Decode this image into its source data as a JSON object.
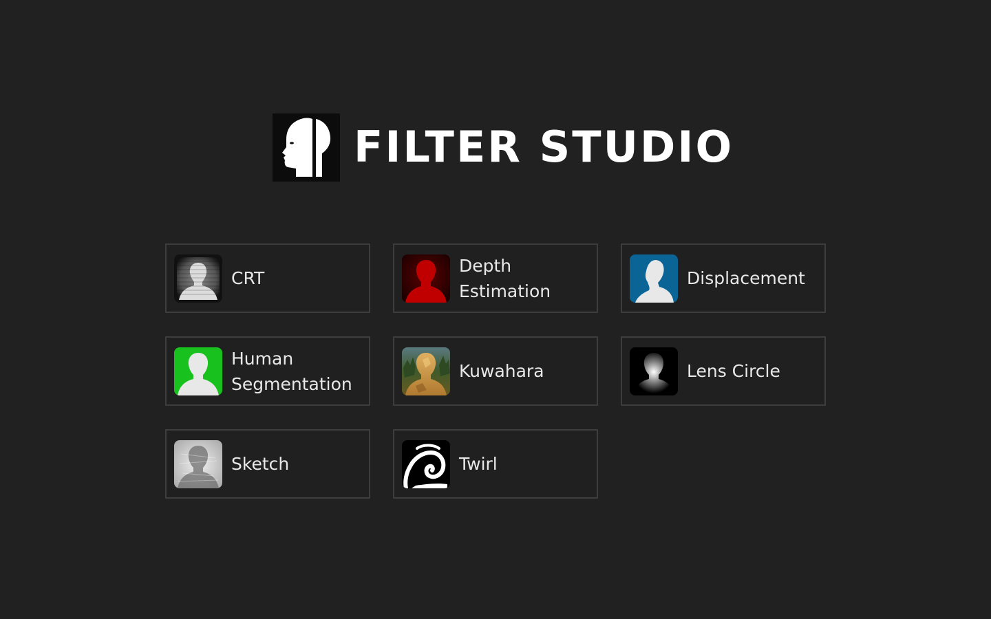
{
  "app": {
    "title": "FILTER STUDIO",
    "logo_icon": "profile-head-icon"
  },
  "filters": [
    {
      "label": "CRT",
      "icon": "crt-icon"
    },
    {
      "label": "Depth\nEstimation",
      "icon": "depth-estimation-icon"
    },
    {
      "label": "Displacement",
      "icon": "displacement-icon"
    },
    {
      "label": "Human\nSegmentation",
      "icon": "human-segmentation-icon"
    },
    {
      "label": "Kuwahara",
      "icon": "kuwahara-icon"
    },
    {
      "label": "Lens Circle",
      "icon": "lens-circle-icon"
    },
    {
      "label": "Sketch",
      "icon": "sketch-icon"
    },
    {
      "label": "Twirl",
      "icon": "twirl-icon"
    }
  ],
  "colors": {
    "background": "#212121",
    "tile_border": "#3d3d3d",
    "depth_red": "#c00000",
    "displacement_blue": "#0a6496",
    "segmentation_green": "#18c11e"
  }
}
